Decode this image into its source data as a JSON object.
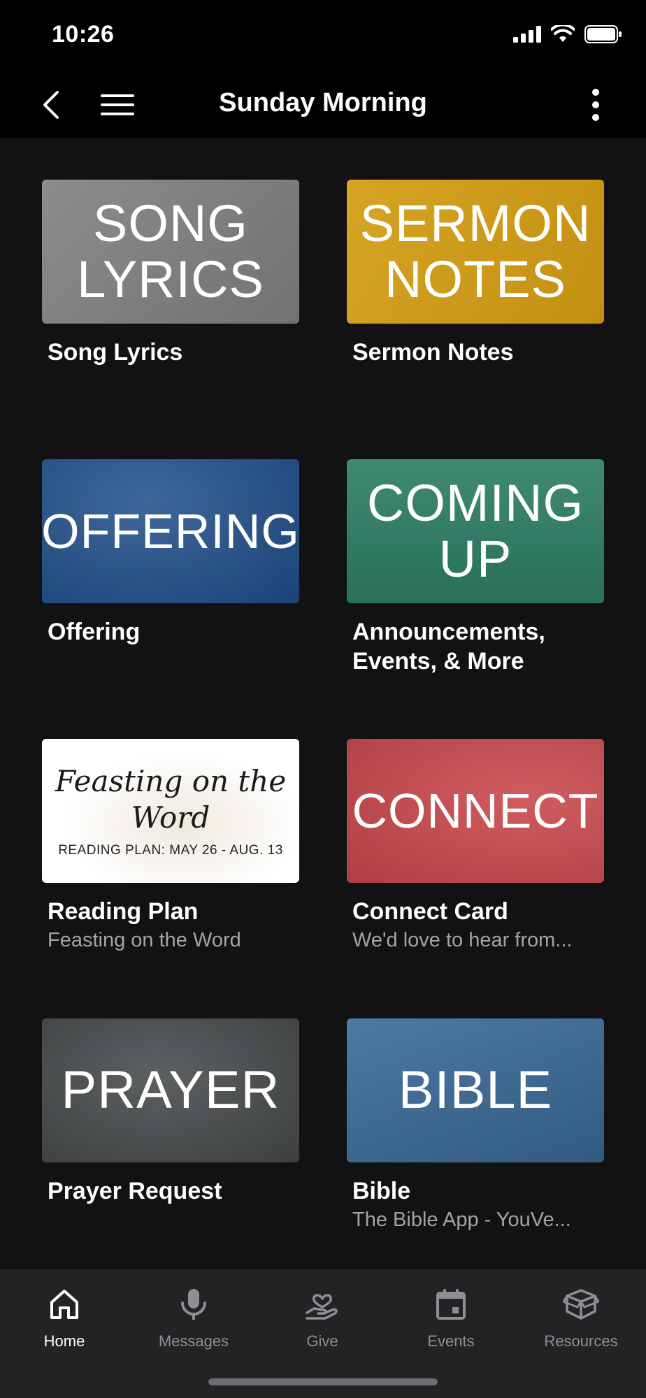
{
  "status": {
    "time": "10:26"
  },
  "nav": {
    "title": "Sunday Morning"
  },
  "tiles": [
    {
      "banner_line1": "SONG",
      "banner_line2": "LYRICS",
      "title": "Song Lyrics",
      "subtitle": "",
      "color": "#7d7f81"
    },
    {
      "banner_line1": "SERMON",
      "banner_line2": "NOTES",
      "title": "Sermon Notes",
      "subtitle": "",
      "color": "#d4a017"
    },
    {
      "banner_line1": "OFFERING",
      "banner_line2": "",
      "title": "Offering",
      "subtitle": "",
      "color": "#1f4e8a"
    },
    {
      "banner_line1": "COMING",
      "banner_line2": "UP",
      "title": "Announcements, Events, & More",
      "subtitle": "",
      "color": "#2f7f67"
    },
    {
      "banner_line1": "Feasting on the Word",
      "banner_line2": "READING PLAN: MAY 26 - AUG. 13",
      "title": "Reading Plan",
      "subtitle": "Feasting on the Word",
      "color": "#ffffff"
    },
    {
      "banner_line1": "CONNECT",
      "banner_line2": "",
      "title": "Connect Card",
      "subtitle": "We'd love to hear from...",
      "color": "#c9474a"
    },
    {
      "banner_line1": "PRAYER",
      "banner_line2": "",
      "title": "Prayer Request",
      "subtitle": "",
      "color": "#4b4e50"
    },
    {
      "banner_line1": "BIBLE",
      "banner_line2": "",
      "title": "Bible",
      "subtitle": "The Bible App - YouVe...",
      "color": "#3a6a98"
    }
  ],
  "tabs": [
    {
      "label": "Home",
      "icon": "home-icon",
      "active": true
    },
    {
      "label": "Messages",
      "icon": "microphone-icon",
      "active": false
    },
    {
      "label": "Give",
      "icon": "give-hand-heart-icon",
      "active": false
    },
    {
      "label": "Events",
      "icon": "calendar-icon",
      "active": false
    },
    {
      "label": "Resources",
      "icon": "box-icon",
      "active": false
    }
  ]
}
